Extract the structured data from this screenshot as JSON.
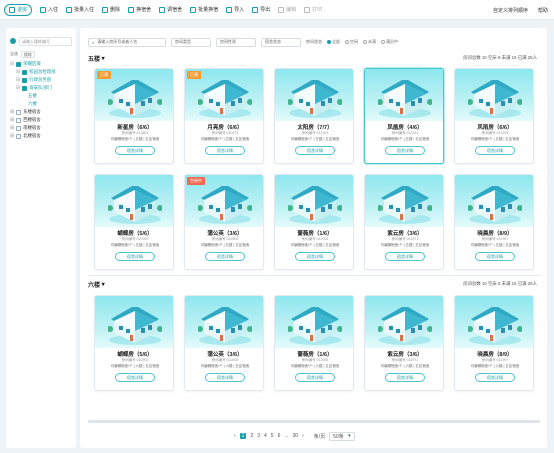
{
  "toolbar": {
    "items": [
      {
        "label": "退房",
        "icon": "home-icon"
      },
      {
        "label": "入住",
        "icon": "checkin-icon"
      },
      {
        "label": "批量入住",
        "icon": "batch-checkin-icon"
      },
      {
        "label": "删除",
        "icon": "delete-icon"
      },
      {
        "label": "换宿舍",
        "icon": "swap-icon"
      },
      {
        "label": "调宿舍",
        "icon": "adjust-icon"
      },
      {
        "label": "批量换宿",
        "icon": "batch-swap-icon"
      },
      {
        "label": "导入",
        "icon": "import-icon"
      },
      {
        "label": "导出",
        "icon": "export-icon"
      },
      {
        "label": "编辑",
        "icon": "edit-icon"
      },
      {
        "label": "打印",
        "icon": "print-icon"
      }
    ],
    "right": [
      "自定义排列顺序",
      "帮助"
    ]
  },
  "sidebar": {
    "search_placeholder": "请输入楼栋编号",
    "opt1": "全选",
    "opt2": "楼栋",
    "tree": [
      {
        "label": "荣耀区域",
        "cls": "sel2",
        "cb": "on"
      },
      {
        "label": "校园总经理部",
        "cls": "sel2",
        "cb": "on"
      },
      {
        "label": "行政总务部",
        "cls": "sel2",
        "cb": "on"
      },
      {
        "label": "保安队/部门",
        "cls": "sel2",
        "cb": "on"
      },
      {
        "label": "五楼",
        "cls": "leaf",
        "cb": "none"
      },
      {
        "label": "六楼",
        "cls": "leaf",
        "cb": "none"
      },
      {
        "label": "东楼宿舍",
        "cls": "",
        "cb": ""
      },
      {
        "label": "西楼宿舍",
        "cls": "",
        "cb": ""
      },
      {
        "label": "南楼宿舍",
        "cls": "",
        "cb": ""
      },
      {
        "label": "北楼宿舍",
        "cls": "",
        "cb": ""
      }
    ]
  },
  "filters": {
    "search_placeholder": "请输入房间号或者人名",
    "sel1": "房间类型",
    "sel2": "房间性质",
    "sel3": "宿舍状态",
    "status_label": "房间状态",
    "opts": [
      "全部",
      "空闲",
      "未满",
      "满员中"
    ]
  },
  "sections": [
    {
      "title": "五楼",
      "stats": "房间总数 10 空床 8 未满 16 已满 25人",
      "cards": [
        {
          "name": "新星房（6/6）",
          "tag": "已满",
          "tagc": "",
          "sub": "房间编号:013853",
          "info": "可编辑宿舍/个  |  五楼  |  五区宿舍"
        },
        {
          "name": "月亮房（6/6）",
          "tag": "已满",
          "tagc": "",
          "sub": "房间编号:010572",
          "info": "可编辑宿舍/个  |  五楼  |  五区宿舍"
        },
        {
          "name": "太阳房（7/7）",
          "tag": "",
          "tagc": "",
          "sub": "房间编号:012303",
          "info": "可编辑宿舍/个  |  五楼  |  五区宿舍"
        },
        {
          "name": "凤凰房（4/6）",
          "tag": "",
          "tagc": "",
          "sub": "房间编号:012291",
          "info": "可编辑宿舍/个  |  五楼  |  五区宿舍",
          "hl": true
        },
        {
          "name": "风雨房（6/6）",
          "tag": "",
          "tagc": "",
          "sub": "房间编号:013298",
          "info": "可编辑宿舍/个  |  五楼  |  五区宿舍"
        },
        {
          "name": "蝴蝶房（5/6）",
          "tag": "",
          "tagc": "",
          "sub": "房间编号:010903",
          "info": "可编辑宿舍/个  |  五楼  |  五区宿舍"
        },
        {
          "name": "蒲公英（3/6）",
          "tag": "空闲中",
          "tagc": "red",
          "sub": "房间编号:012805",
          "info": "可编辑宿舍/个  |  五楼  |  五区宿舍"
        },
        {
          "name": "蔷薇房（1/6）",
          "tag": "",
          "tagc": "",
          "sub": "房间编号:012006",
          "info": "可编辑宿舍/个  |  五楼  |  五区宿舍"
        },
        {
          "name": "紫云房（3/6）",
          "tag": "",
          "tagc": "",
          "sub": "房间编号:012971",
          "info": "可编辑宿舍/个  |  五楼  |  五区宿舍"
        },
        {
          "name": "晓晨房（8/9）",
          "tag": "",
          "tagc": "",
          "sub": "房间编号:012997",
          "info": "可编辑宿舍/个  |  五楼  |  五区宿舍"
        }
      ]
    },
    {
      "title": "六楼",
      "stats": "房间总数 10 空床 8 未满 16 已满 25人",
      "cards": [
        {
          "name": "蝴蝶房（5/6）",
          "tag": "",
          "tagc": "",
          "sub": "房间编号:010903",
          "info": "可编辑宿舍/个  |  六楼  |  五区宿舍"
        },
        {
          "name": "蒲公英（3/6）",
          "tag": "",
          "tagc": "",
          "sub": "房间编号:012805",
          "info": "可编辑宿舍/个  |  六楼  |  五区宿舍"
        },
        {
          "name": "蔷薇房（1/6）",
          "tag": "",
          "tagc": "",
          "sub": "房间编号:012006",
          "info": "可编辑宿舍/个  |  六楼  |  五区宿舍"
        },
        {
          "name": "紫云房（3/6）",
          "tag": "",
          "tagc": "",
          "sub": "房间编号:012971",
          "info": "可编辑宿舍/个  |  六楼  |  五区宿舍"
        },
        {
          "name": "晓晨房（8/9）",
          "tag": "",
          "tagc": "",
          "sub": "房间编号:012997",
          "info": "可编辑宿舍/个  |  六楼  |  五区宿舍"
        }
      ]
    }
  ],
  "card_button": "宿舍详情",
  "pager": {
    "pages": [
      "1",
      "2",
      "3",
      "4",
      "5",
      "6",
      "...",
      "30"
    ],
    "current": "1",
    "size_label": "条/页",
    "size": "50条"
  }
}
